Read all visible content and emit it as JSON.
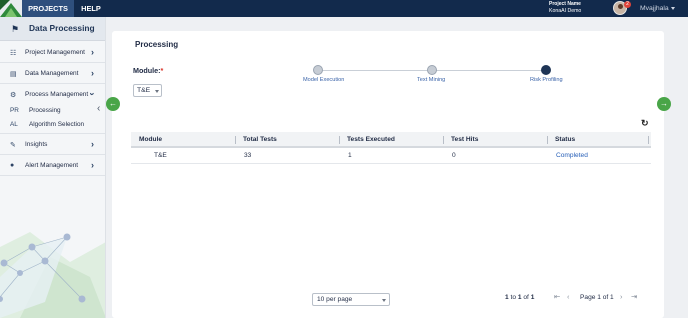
{
  "header": {
    "tabs": [
      {
        "label": "PROJECTS"
      },
      {
        "label": "HELP"
      }
    ],
    "project_label": "Project Name",
    "project_name": "KonaAI Demo",
    "notification_count": "2",
    "user_name": "Mvajjhala"
  },
  "sidebar": {
    "title": "Data Processing",
    "items": [
      {
        "label": "Project Management",
        "icon": "sitemap-icon"
      },
      {
        "label": "Data Management",
        "icon": "database-icon"
      },
      {
        "label": "Process Management",
        "icon": "gears-icon"
      },
      {
        "label": "Insights",
        "icon": "edit-icon"
      },
      {
        "label": "Alert Management",
        "icon": "users-icon"
      }
    ],
    "sub_items": [
      {
        "prefix": "PR",
        "label": "Processing"
      },
      {
        "prefix": "AL",
        "label": "Algorithm Selection"
      }
    ]
  },
  "main": {
    "title": "Processing",
    "module_label": "Module:",
    "module_required_mark": "*",
    "module_value": "T&E",
    "steps": [
      {
        "label": "Model Execution",
        "state": "done"
      },
      {
        "label": "Text Mining",
        "state": "done"
      },
      {
        "label": "Risk Profiling",
        "state": "current"
      }
    ],
    "table": {
      "columns": [
        "Module",
        "Total Tests",
        "Tests Executed",
        "Test Hits",
        "Status"
      ],
      "rows": [
        {
          "module": "T&E",
          "total_tests": "33",
          "tests_executed": "1",
          "test_hits": "0",
          "status": "Completed"
        }
      ]
    },
    "pagination": {
      "per_page": "10 per page",
      "range_start": "1",
      "range_sep": "to",
      "range_end": "1",
      "of_text": "of",
      "total": "1",
      "page_text": "Page 1 of 1"
    }
  },
  "colors": {
    "topbar": "#122a4c",
    "accent_green": "#49a548",
    "status_link": "#2860b8",
    "active_step": "#1f3556"
  }
}
